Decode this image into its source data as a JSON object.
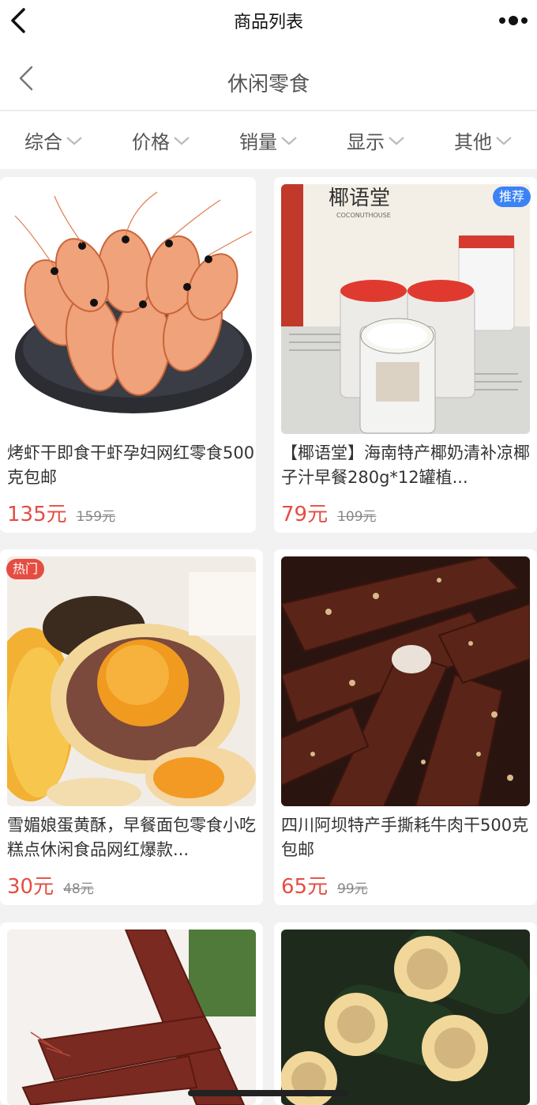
{
  "navbar": {
    "title": "商品列表"
  },
  "subbar": {
    "title": "休闲零食"
  },
  "filters": [
    {
      "label": "综合"
    },
    {
      "label": "价格"
    },
    {
      "label": "销量"
    },
    {
      "label": "显示"
    },
    {
      "label": "其他"
    }
  ],
  "products": [
    {
      "name": "烤虾干即食干虾孕妇网红零食500克包邮",
      "price": "135元",
      "old_price": "159元",
      "badge": ""
    },
    {
      "name": "【椰语堂】海南特产椰奶清补凉椰子汁早餐280g*12罐植...",
      "price": "79元",
      "old_price": "109元",
      "badge": "推荐"
    },
    {
      "name": "雪媚娘蛋黄酥，早餐面包零食小吃糕点休闲食品网红爆款...",
      "price": "30元",
      "old_price": "48元",
      "badge": "热门"
    },
    {
      "name": "四川阿坝特产手撕耗牛肉干500克包邮",
      "price": "65元",
      "old_price": "99元",
      "badge": ""
    },
    {
      "name": "",
      "price": "",
      "old_price": "",
      "badge": ""
    },
    {
      "name": "",
      "price": "",
      "old_price": "",
      "badge": ""
    }
  ],
  "image_texts": {
    "coconut_brand": "椰语堂",
    "coconut_sub": "COCONUTHOUSE"
  },
  "colors": {
    "price": "#e54d42",
    "badge_recommend": "#3b82f6",
    "badge_hot": "#e54d42"
  }
}
